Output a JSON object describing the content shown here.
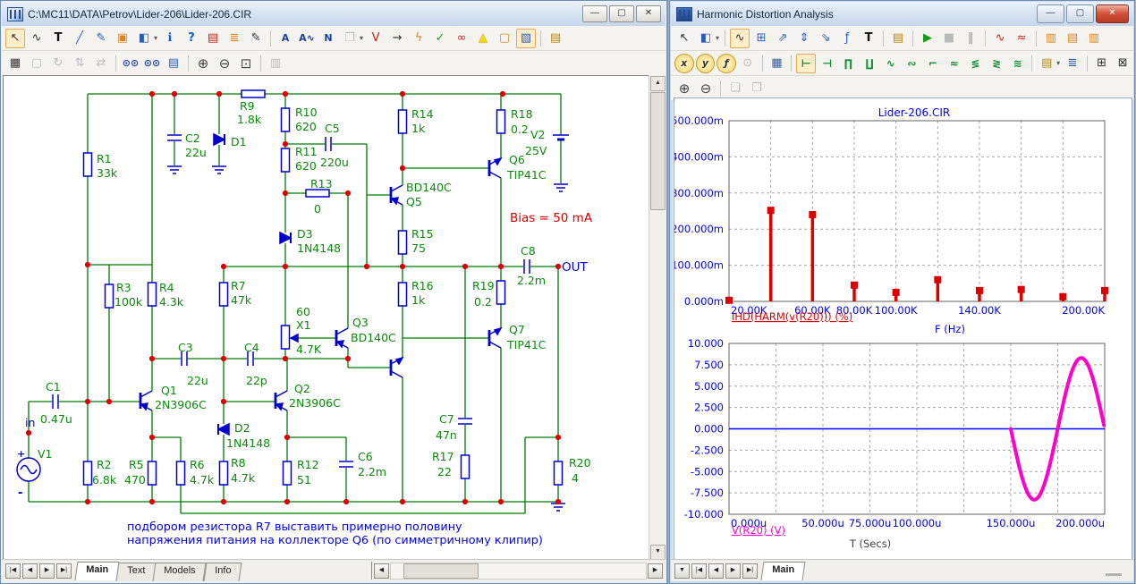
{
  "left_window": {
    "title": "C:\\MC11\\DATA\\Petrov\\Lider-206\\Lider-206.CIR",
    "titlebar_buttons": [
      {
        "n": "minimize-button",
        "g": "—"
      },
      {
        "n": "maximize-button",
        "g": "▢"
      },
      {
        "n": "close-button",
        "g": "✕"
      }
    ],
    "toolbar_row1": [
      {
        "n": "select-tool-icon",
        "g": "↖",
        "p": 1,
        "c": "dark"
      },
      {
        "n": "wire-mode-icon",
        "g": "∿",
        "c": "dark"
      },
      {
        "n": "text-mode-icon",
        "g": "T",
        "c": "bold"
      },
      {
        "n": "line-mode-icon",
        "g": "╱",
        "c": "blue"
      },
      {
        "n": "graphics-mode-icon",
        "g": "✎",
        "c": "blue"
      },
      {
        "n": "picture-mode-icon",
        "g": "▣",
        "c": "orange"
      },
      {
        "n": "component-shape-icon",
        "g": "◧",
        "c": "blue",
        "dd": 1
      },
      {
        "n": "info-mode-icon",
        "g": "ℹ",
        "c": "info"
      },
      {
        "n": "help-mode-icon",
        "g": "?",
        "c": "info"
      },
      {
        "n": "model-check-icon",
        "g": "▤",
        "c": "red"
      },
      {
        "n": "file-list-icon",
        "g": "≣",
        "c": "orange"
      },
      {
        "n": "edit-notes-icon",
        "g": "✎",
        "c": "dark"
      },
      {
        "sep": 1
      },
      {
        "n": "find-text-icon",
        "g": "A",
        "c": "find"
      },
      {
        "n": "find-wave-icon",
        "g": "A∿",
        "c": "find"
      },
      {
        "n": "find-node-icon",
        "g": "N",
        "c": "find"
      },
      {
        "n": "paste-icon",
        "g": "❐",
        "d": 1,
        "dd": 1
      },
      {
        "n": "find-voltage-icon",
        "g": "V",
        "c": "red"
      },
      {
        "n": "show-node-numbers-icon",
        "g": "→",
        "c": "dark"
      },
      {
        "n": "show-node-voltages-icon",
        "g": "ϟ",
        "c": "orange"
      },
      {
        "n": "show-measurements-icon",
        "g": "✓",
        "c": "green"
      },
      {
        "n": "show-pin-connections-icon",
        "g": "∞",
        "c": "red"
      },
      {
        "n": "show-warnings-icon",
        "g": "▲",
        "c": "yellow"
      },
      {
        "n": "new-page-icon",
        "g": "▢",
        "c": "orange"
      },
      {
        "n": "block-select-mode-icon",
        "g": "▧",
        "c": "blue",
        "p": 1
      },
      {
        "sep": 1
      },
      {
        "n": "properties-icon",
        "g": "▤",
        "c": "gold"
      }
    ],
    "toolbar_row2": [
      {
        "n": "select-region-icon",
        "g": "▦",
        "c": "dark"
      },
      {
        "n": "scale-region-icon",
        "g": "▢",
        "d": 1
      },
      {
        "n": "rotate-icon",
        "g": "↻",
        "d": 1
      },
      {
        "n": "flip-vertical-icon",
        "g": "⇅",
        "d": 1
      },
      {
        "n": "flip-horizontal-icon",
        "g": "⇄",
        "d": 1
      },
      {
        "sep": 1
      },
      {
        "n": "find-icon",
        "g": "⊙⊙",
        "c": "find"
      },
      {
        "n": "find-repeat-icon",
        "g": "⊙⊙",
        "c": "find"
      },
      {
        "n": "goto-flag-icon",
        "g": "▤",
        "c": "blue"
      },
      {
        "sep": 1
      },
      {
        "n": "zoom-in-icon",
        "g": "⊕",
        "c": "zoom"
      },
      {
        "n": "zoom-out-icon",
        "g": "⊖",
        "c": "zoom"
      },
      {
        "n": "zoom-area-icon",
        "g": "⊡",
        "c": "zoom"
      },
      {
        "sep": 1
      },
      {
        "n": "copy-view-icon",
        "g": "▥",
        "d": 1
      }
    ],
    "nav_buttons": [
      "|◀",
      "◀",
      "▶",
      "▶|"
    ],
    "tabs": [
      "Main",
      "Text",
      "Models",
      "Info"
    ],
    "active_tab": "Main",
    "schematic": {
      "components": [
        {
          "ref": "R1",
          "value": "33k"
        },
        {
          "ref": "C2",
          "value": "22u"
        },
        {
          "ref": "D1",
          "value": ""
        },
        {
          "ref": "R9",
          "value": "1.8k"
        },
        {
          "ref": "R10",
          "value": "620"
        },
        {
          "ref": "C5",
          "value": "220u"
        },
        {
          "ref": "R11",
          "value": "620"
        },
        {
          "ref": "R13",
          "value": "0"
        },
        {
          "ref": "D3",
          "value": "1N4148"
        },
        {
          "ref": "R14",
          "value": "1k"
        },
        {
          "ref": "R18",
          "value": "0.2"
        },
        {
          "ref": "V2",
          "value": "25V"
        },
        {
          "ref": "Q6",
          "value": "TIP41C"
        },
        {
          "ref": "Q5",
          "value": "BD140C"
        },
        {
          "ref": "R15",
          "value": "75"
        },
        {
          "ref": "C8",
          "value": "2.2m"
        },
        {
          "ref": "R16",
          "value": "1k"
        },
        {
          "ref": "R19",
          "value": "0.2"
        },
        {
          "ref": "Q7",
          "value": "TIP41C"
        },
        {
          "ref": "Q3",
          "value": "BD140C"
        },
        {
          "ref": "X1",
          "value": "4.7K"
        },
        {
          "ref": "R7",
          "value": "47k"
        },
        {
          "ref": "R3",
          "value": "100k"
        },
        {
          "ref": "R4",
          "value": "4.3k"
        },
        {
          "ref": "C3",
          "value": "22u"
        },
        {
          "ref": "C4",
          "value": "22p"
        },
        {
          "ref": "Q1",
          "value": "2N3906C"
        },
        {
          "ref": "Q2",
          "value": "2N3906C"
        },
        {
          "ref": "D2",
          "value": "1N4148"
        },
        {
          "ref": "C1",
          "value": "0.47u"
        },
        {
          "ref": "V1",
          "value": ""
        },
        {
          "ref": "R2",
          "value": "6.8k"
        },
        {
          "ref": "R5",
          "value": "470"
        },
        {
          "ref": "R6",
          "value": "4.7k"
        },
        {
          "ref": "R8",
          "value": "4.7k"
        },
        {
          "ref": "R12",
          "value": "51"
        },
        {
          "ref": "C6",
          "value": "2.2m"
        },
        {
          "ref": "C7",
          "value": "47n"
        },
        {
          "ref": "R17",
          "value": "22"
        },
        {
          "ref": "R20",
          "value": "4"
        }
      ],
      "labels": {
        "in": "in",
        "out": "OUT",
        "bias": "Bias = 50 mA",
        "pot_setting": "60",
        "plus": "+",
        "minus": "-",
        "note1": "подбором резистора R7 выставить примерно половину",
        "note2": "напряжения питания на коллекторе Q6 (по симметричному клипир)"
      },
      "colors": {
        "wire": "#007a00",
        "symbol": "#0000cc",
        "junction": "#dd0000",
        "text": "#0b8a0b",
        "annotation": "#0000ee",
        "warning": "#dd0000"
      }
    }
  },
  "right_window": {
    "title": "Harmonic Distortion Analysis",
    "titlebar_buttons": [
      {
        "n": "minimize-button",
        "g": "—"
      },
      {
        "n": "maximize-button",
        "g": "▢"
      },
      {
        "n": "close-button",
        "g": "✕"
      }
    ],
    "toolbar_row1": [
      {
        "n": "select-tool-icon",
        "g": "↖",
        "c": "dark"
      },
      {
        "n": "graphics-shape-icon",
        "g": "◧",
        "c": "blue",
        "dd": 1
      },
      {
        "sep": 1
      },
      {
        "n": "scope-mode-icon",
        "g": "∿",
        "c": "dark",
        "p": 1
      },
      {
        "n": "data-points-icon",
        "g": "⊞",
        "c": "blue"
      },
      {
        "n": "scale-mode-icon",
        "g": "⇗",
        "c": "blue"
      },
      {
        "n": "vertical-scale-icon",
        "g": "⇕",
        "c": "blue"
      },
      {
        "n": "next-object-icon",
        "g": "⇘",
        "c": "blue"
      },
      {
        "n": "formula-mode-icon",
        "g": "ƒ",
        "c": "blue"
      },
      {
        "n": "text-mode-icon",
        "g": "T",
        "c": "bold"
      },
      {
        "sep": 1
      },
      {
        "n": "properties-icon",
        "g": "▤",
        "c": "gold"
      },
      {
        "sep": 1
      },
      {
        "n": "run-icon",
        "g": "▶",
        "c": "green"
      },
      {
        "n": "stop-icon",
        "g": "■",
        "d": 1
      },
      {
        "n": "pause-icon",
        "g": "‖",
        "d": 1,
        "c": "bold"
      },
      {
        "sep": 1
      },
      {
        "n": "thd-plot-icon",
        "g": "∿",
        "c": "red"
      },
      {
        "n": "intermod-plot-icon",
        "g": "≈",
        "c": "red"
      },
      {
        "sep": 1
      },
      {
        "n": "accumulate-plots-icon",
        "g": "▥",
        "c": "orange"
      },
      {
        "n": "overlap-plots-icon",
        "g": "▤",
        "c": "orange"
      },
      {
        "n": "separate-plots-icon",
        "g": "▥",
        "c": "orange"
      }
    ],
    "toolbar_row2": [
      {
        "n": "x-axis-settings-icon",
        "g": "x",
        "c": "circ"
      },
      {
        "n": "y-axis-settings-icon",
        "g": "y",
        "c": "circ"
      },
      {
        "n": "fx-settings-icon",
        "g": "ƒ",
        "c": "circ"
      },
      {
        "n": "search-icon",
        "g": "⊙",
        "d": 1
      },
      {
        "sep": 1
      },
      {
        "n": "edit-limits-icon",
        "g": "▦",
        "c": "blue"
      },
      {
        "sep": 1
      },
      {
        "n": "cursor-left-icon",
        "g": "⊢",
        "c": "green2",
        "p": 1
      },
      {
        "n": "cursor-right-icon",
        "g": "⊣",
        "c": "green2"
      },
      {
        "n": "peak-icon",
        "g": "∏",
        "c": "green2"
      },
      {
        "n": "valley-icon",
        "g": "∐",
        "c": "green2"
      },
      {
        "n": "high-icon",
        "g": "∿",
        "c": "green2"
      },
      {
        "n": "low-icon",
        "g": "∾",
        "c": "green2"
      },
      {
        "n": "slope-icon",
        "g": "⌐",
        "c": "green2"
      },
      {
        "n": "inflection-icon",
        "g": "≈",
        "c": "green2"
      },
      {
        "n": "global-high-icon",
        "g": "≶",
        "c": "green2"
      },
      {
        "n": "global-low-icon",
        "g": "≷",
        "c": "green2"
      },
      {
        "n": "envelope-icon",
        "g": "≋",
        "c": "green2"
      },
      {
        "sep": 1
      },
      {
        "n": "clipboard-icon",
        "g": "▤",
        "c": "gold",
        "dd": 1
      },
      {
        "n": "numeric-output-icon",
        "g": "≣",
        "c": "blue"
      },
      {
        "sep": 1
      },
      {
        "n": "align-cursors-icon",
        "g": "⊞",
        "c": "dark"
      },
      {
        "n": "same-scales-icon",
        "g": "⊠",
        "c": "dark"
      }
    ],
    "toolbar_row3": [
      {
        "n": "zoom-in-icon",
        "g": "⊕",
        "c": "zoom"
      },
      {
        "n": "zoom-out-icon",
        "g": "⊖",
        "c": "zoom"
      },
      {
        "sep": 1
      },
      {
        "n": "bring-to-front-icon",
        "g": "❏",
        "d": 1
      },
      {
        "n": "send-to-back-icon",
        "g": "❐",
        "d": 1
      }
    ],
    "nav_buttons": [
      "▼",
      "|◀",
      "◀",
      "▶",
      "▶|"
    ],
    "tabs": [
      "Main"
    ],
    "active_tab": "Main"
  },
  "chart_data": [
    {
      "type": "stem",
      "title": "Lider-206.CIR",
      "series_label": "IHD(HARM(v(R20))) (%)",
      "xlabel": "F (Hz)",
      "x_hz": [
        20000,
        40000,
        60000,
        80000,
        100000,
        120000,
        140000,
        160000,
        180000,
        200000
      ],
      "values_milli_pct": [
        3,
        252,
        240,
        45,
        25,
        60,
        30,
        33,
        13,
        30
      ],
      "xlim_hz": [
        20000,
        200000
      ],
      "ylim_milli_pct": [
        0,
        500
      ],
      "grid_step_x_hz": 20000,
      "grid_step_y_milli": 100,
      "y_ticks": [
        {
          "v": 500,
          "label": "500.000m"
        },
        {
          "v": 400,
          "label": "400.000m"
        },
        {
          "v": 300,
          "label": "300.000m"
        },
        {
          "v": 200,
          "label": "200.000m"
        },
        {
          "v": 100,
          "label": "100.000m"
        },
        {
          "v": 0,
          "label": "0.000m"
        }
      ],
      "x_ticks": [
        {
          "v": 20000,
          "label": "20.00K"
        },
        {
          "v": 60000,
          "label": "60.00K"
        },
        {
          "v": 80000,
          "label": "80.00K"
        },
        {
          "v": 100000,
          "label": "100.00K"
        },
        {
          "v": 140000,
          "label": "140.00K"
        },
        {
          "v": 200000,
          "label": "200.00K"
        }
      ],
      "stem_color": "#dd0000",
      "tick_color": "#0000ee",
      "grid": "dashed"
    },
    {
      "type": "line",
      "title": "",
      "xlabel": "T (Secs)",
      "series": [
        {
          "name": "V(R20) (V)",
          "color": "#ff00cc",
          "shape": "sine-burst",
          "t_start_us": 150,
          "t_end_us": 200,
          "period_us": 50,
          "amplitude_v": 8.3,
          "polarity": "negative-first"
        },
        {
          "name": "zero-baseline",
          "color": "#0000ff",
          "constant_v": 0
        }
      ],
      "xlim_us": [
        0,
        200
      ],
      "ylim_v": [
        -10,
        10
      ],
      "grid_step_x_us": 25,
      "grid_step_y_v": 2.5,
      "y_ticks": [
        {
          "v": 10,
          "label": "10.000"
        },
        {
          "v": 7.5,
          "label": "7.500"
        },
        {
          "v": 5,
          "label": "5.000"
        },
        {
          "v": 2.5,
          "label": "2.500"
        },
        {
          "v": 0,
          "label": "0.000"
        },
        {
          "v": -2.5,
          "label": "-2.500"
        },
        {
          "v": -5,
          "label": "-5.000"
        },
        {
          "v": -7.5,
          "label": "-7.500"
        },
        {
          "v": -10,
          "label": "-10.000"
        }
      ],
      "x_ticks": [
        {
          "v": 0,
          "label": "0.000u"
        },
        {
          "v": 50,
          "label": "50.000u"
        },
        {
          "v": 75,
          "label": "75.000u"
        },
        {
          "v": 100,
          "label": "100.000u"
        },
        {
          "v": 150,
          "label": "150.000u"
        },
        {
          "v": 200,
          "label": "200.000u"
        }
      ],
      "legend_label": "V(R20) (V)",
      "tick_color": "#0000ee",
      "grid": "dashed"
    }
  ]
}
